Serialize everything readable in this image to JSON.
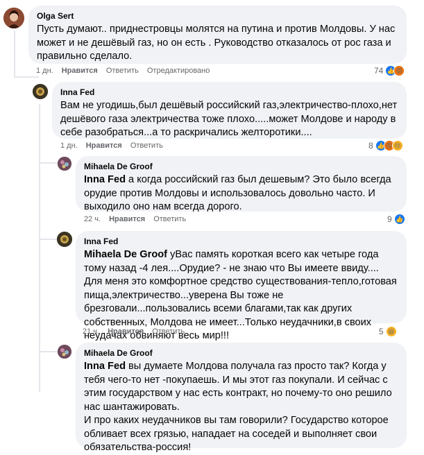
{
  "comments": [
    {
      "author": "Olga Sert",
      "text": "Пусть думают.. приднестровцы молятся на путина и против Молдовы. У нас может и не дешёвый газ, но он есть . Руководство отказалось от рос газа и правильно сделало.",
      "time": "1 дн.",
      "like_label": "Нравится",
      "reply_label": "Ответить",
      "edited_label": "Отредактировано",
      "reaction_count": "74",
      "reactions": [
        "like-icon",
        "angry-icon"
      ]
    },
    {
      "author": "Inna Fed",
      "text": "Вам не угодишь,был дешёвый российский газ,электричество-плохо,нет дешёвого газа электричества тоже плохо.....может Молдове и народу в себе разобраться...а то раскричались желторотики....",
      "time": "1 дн.",
      "like_label": "Нравится",
      "reply_label": "Ответить",
      "reaction_count": "8",
      "reactions": [
        "like-icon",
        "angry-icon",
        "sad-icon"
      ]
    },
    {
      "author": "Mihaela De Groof",
      "mention": "Inna Fed",
      "text": " а когда российский газ был дешевым? Это было всегда орудие против Молдовы и использовалось довольно часто. И выходило оно нам всегда дорого.",
      "time": "22 ч.",
      "like_label": "Нравится",
      "reply_label": "Ответить",
      "reaction_count": "9",
      "reactions": [
        "like-icon"
      ]
    },
    {
      "author": "Inna Fed",
      "mention": "Mihaela De Groof",
      "text": " уВас память короткая всего как четыре года тому назад -4 лея....Орудие? - не знаю что Вы имеете ввиду.... Для меня это комфортное средство существования-тепло,готовая пища,электричество...уверена Вы тоже не брезговали...пользовались всеми благами,так как других собственных, Молдова не имеет...Только неудачники,в своих неудачах обвиняют весь мир!!!",
      "time": "21 ч.",
      "like_label": "Нравится",
      "reply_label": "Ответить",
      "reaction_count": "5",
      "reactions": [
        "haha-icon"
      ]
    },
    {
      "author": "Mihaela De Groof",
      "mention": "Inna Fed",
      "text": " вы думаете Молдова получала газ просто так? Когда у тебя чего-то нет -покупаешь. И мы этот газ покупали. И сейчас с этим государством у нас есть контракт, но почему-то оно решило нас шантажировать.\nИ про каких неудачников вы там говорили? Государство которое обливает всех грязью, нападает на соседей и выполняет свои обязательства-россия!"
    }
  ],
  "colors": {
    "bubble": "#f0f2f5",
    "meta_text": "#65676b",
    "like_blue": "#1877f2",
    "angry_orange": "#e9710f",
    "yellow": "#f7b125"
  }
}
